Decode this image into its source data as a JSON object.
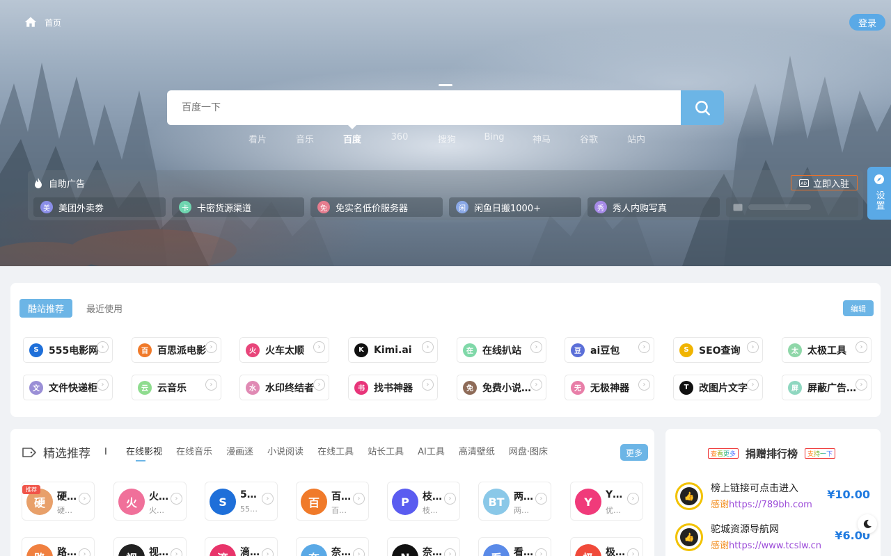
{
  "header": {
    "home_label": "首页",
    "login_label": "登录"
  },
  "search": {
    "placeholder": "百度一下",
    "engines": [
      "看片",
      "音乐",
      "百度",
      "360",
      "搜狗",
      "Bing",
      "神马",
      "谷歌",
      "站内"
    ],
    "active_engine": "百度"
  },
  "ads": {
    "title": "自助广告",
    "join_label": "立即入驻",
    "items": [
      {
        "label": "美团外卖劵",
        "avatar": "美",
        "color": "#8a8ee8"
      },
      {
        "label": "卡密货源渠道",
        "avatar": "卡",
        "color": "#6fd6b0"
      },
      {
        "label": "免实名低价服务器",
        "avatar": "免",
        "color": "#e67d8f"
      },
      {
        "label": "闲鱼日搬1000+",
        "avatar": "闲",
        "color": "#8aa8e6"
      },
      {
        "label": "秀人内购写真",
        "avatar": "秀",
        "color": "#a78be8"
      }
    ]
  },
  "side": {
    "settings_label": "设置"
  },
  "quick": {
    "tabs": [
      "酷站推荐",
      "最近使用"
    ],
    "edit_label": "编辑",
    "items": [
      {
        "name": "555电影网",
        "icon": "S",
        "color": "#1e6fd9"
      },
      {
        "name": "百思派电影",
        "icon": "百",
        "color": "#f07a2a"
      },
      {
        "name": "火车太顺",
        "icon": "火",
        "color": "#e8457a"
      },
      {
        "name": "Kimi.ai",
        "icon": "K",
        "color": "#111111"
      },
      {
        "name": "在线扒站",
        "icon": "在",
        "color": "#7fd8a8"
      },
      {
        "name": "ai豆包",
        "icon": "豆",
        "color": "#5b6fd8"
      },
      {
        "name": "SEO查询",
        "icon": "S",
        "color": "#f0b400"
      },
      {
        "name": "太极工具",
        "icon": "太",
        "color": "#8fd7a9"
      },
      {
        "name": "文件快递柜",
        "icon": "文",
        "color": "#9a8fd6"
      },
      {
        "name": "云音乐",
        "icon": "云",
        "color": "#8fdc8f"
      },
      {
        "name": "水印终结者",
        "icon": "水",
        "color": "#e08ab4"
      },
      {
        "name": "找书神器",
        "icon": "书",
        "color": "#e8357a"
      },
      {
        "name": "免费小说…",
        "icon": "免",
        "color": "#8e6b58"
      },
      {
        "name": "无极神器",
        "icon": "无",
        "color": "#e87ea8"
      },
      {
        "name": "改图片文字",
        "icon": "T",
        "color": "#111111"
      },
      {
        "name": "屏蔽广告…",
        "icon": "屏",
        "color": "#8fd7c0"
      }
    ]
  },
  "featured": {
    "title": "精选推荐",
    "separator": "I",
    "tabs": [
      "在线影视",
      "在线音乐",
      "漫画迷",
      "小说阅读",
      "在线工具",
      "站长工具",
      "AI工具",
      "高清壁纸",
      "网盘·图床"
    ],
    "more_label": "更多",
    "badge": "推荐",
    "items": [
      {
        "n1": "硬…",
        "n2": "硬…",
        "icon": "硬",
        "color": "#e8a06a"
      },
      {
        "n1": "火…",
        "n2": "火…",
        "icon": "火",
        "color": "#f0709a"
      },
      {
        "n1": "5…",
        "n2": "55…",
        "icon": "S",
        "color": "#1e6fd9"
      },
      {
        "n1": "百…",
        "n2": "百…",
        "icon": "百",
        "color": "#f07a2a"
      },
      {
        "n1": "枝…",
        "n2": "枝…",
        "icon": "P",
        "color": "#5a5cf0"
      },
      {
        "n1": "两…",
        "n2": "两…",
        "icon": "BT",
        "color": "#8ac8e8"
      },
      {
        "n1": "Y…",
        "n2": "优…",
        "icon": "Y",
        "color": "#f03a7a"
      },
      {
        "n1": "路…",
        "n2": "",
        "icon": "路",
        "color": "#f08040"
      },
      {
        "n1": "视…",
        "n2": "",
        "icon": "视",
        "color": "#222222"
      },
      {
        "n1": "滴…",
        "n2": "",
        "icon": "滴",
        "color": "#e8346a"
      },
      {
        "n1": "奈…",
        "n2": "",
        "icon": "奈",
        "color": "#5aa9e6"
      },
      {
        "n1": "奈…",
        "n2": "",
        "icon": "N",
        "color": "#111111"
      },
      {
        "n1": "看…",
        "n2": "",
        "icon": "看",
        "color": "#5a8ae8"
      },
      {
        "n1": "极…",
        "n2": "",
        "icon": "极",
        "color": "#f04a3a"
      }
    ]
  },
  "ranking": {
    "title": "捐赠排行榜",
    "tag_left": "查看更多",
    "tag_right": "支持一下",
    "items": [
      {
        "name": "榜上链接可点击进入",
        "thanks": "感谢",
        "url": "https://789bh.com",
        "price": "¥10.00"
      },
      {
        "name": "驼城资源导航网",
        "thanks": "感谢",
        "url": "https://www.tcslw.cn",
        "price": "¥6.00"
      }
    ]
  }
}
